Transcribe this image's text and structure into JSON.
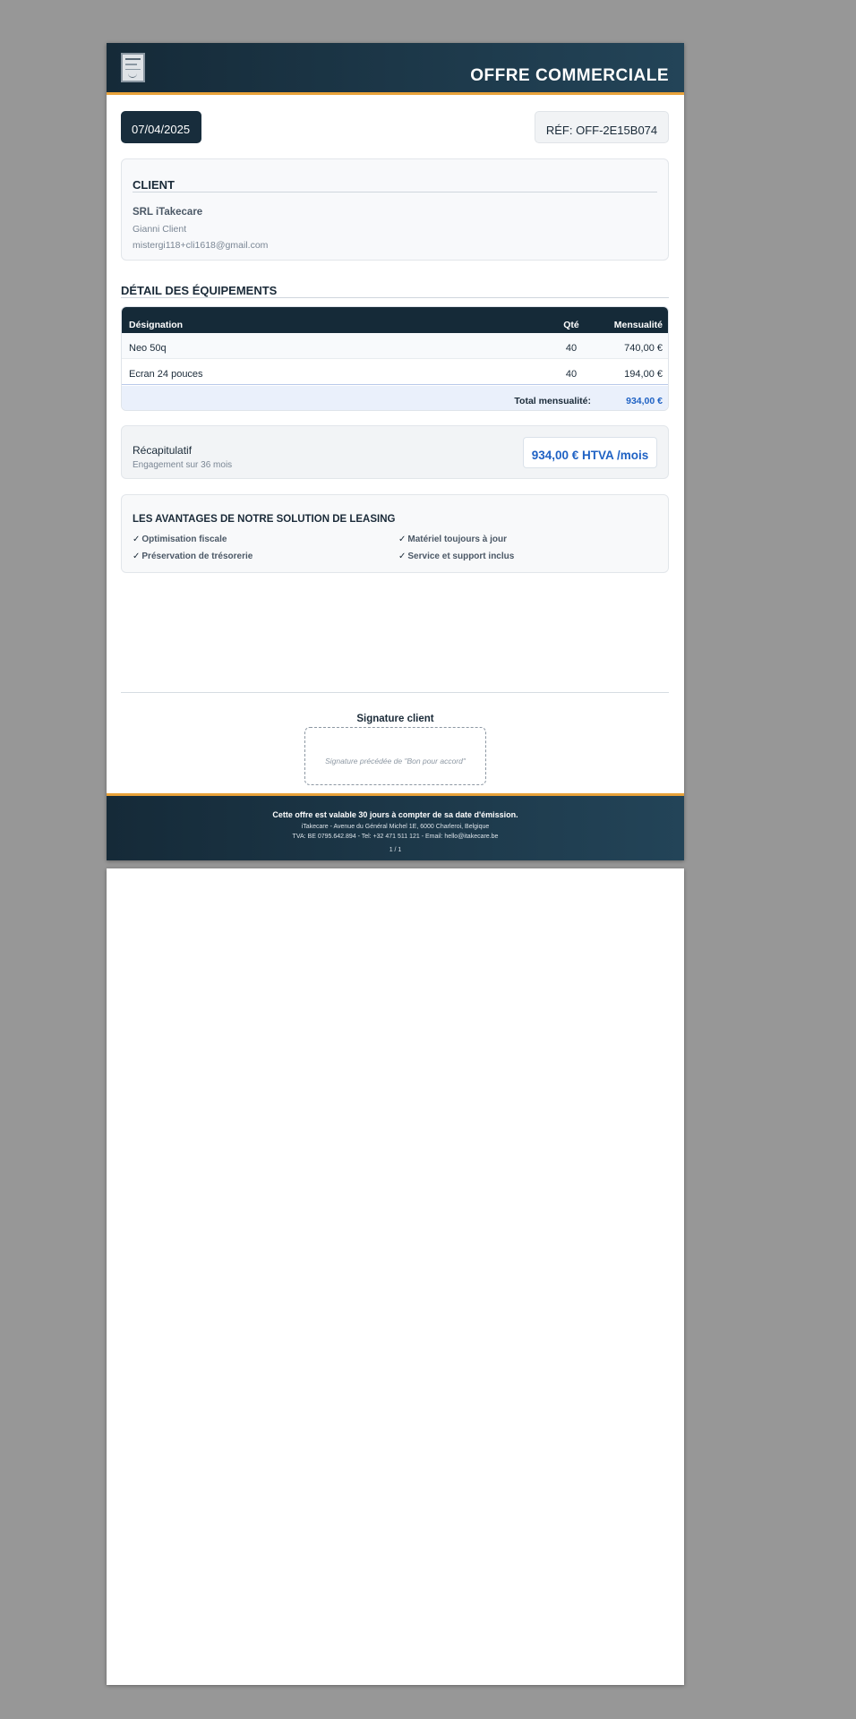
{
  "header": {
    "title": "OFFRE COMMERCIALE",
    "logo_icon": "company-logo"
  },
  "meta": {
    "date": "07/04/2025",
    "reference": "RÉF: OFF-2E15B074"
  },
  "client": {
    "heading": "CLIENT",
    "company": "SRL iTakecare",
    "name": "Gianni Client",
    "email": "mistergi118+cli1618@gmail.com"
  },
  "equipment": {
    "title": "DÉTAIL DES ÉQUIPEMENTS",
    "columns": {
      "designation": "Désignation",
      "quantity": "Qté",
      "monthly": "Mensualité"
    },
    "rows": [
      {
        "designation": "Neo 50q",
        "quantity": "40",
        "monthly": "740,00 €"
      },
      {
        "designation": "Ecran 24 pouces",
        "quantity": "40",
        "monthly": "194,00 €"
      }
    ],
    "total_label": "Total mensualité:",
    "total_value": "934,00 €"
  },
  "recap": {
    "title": "Récapitulatif",
    "subtitle": "Engagement sur 36 mois",
    "price": "934,00 € HTVA /mois"
  },
  "advantages": {
    "title": "LES AVANTAGES DE NOTRE SOLUTION DE LEASING",
    "check_symbol": "✓",
    "items": [
      "Optimisation fiscale",
      "Matériel toujours à jour",
      "Préservation de trésorerie",
      "Service et support inclus"
    ]
  },
  "signature": {
    "label": "Signature client",
    "hint": "Signature précédée de \"Bon pour accord\""
  },
  "footer": {
    "validity": "Cette offre est valable 30 jours à compter de sa date d'émission.",
    "address": "iTakecare - Avenue du Général Michel 1E, 6000 Charleroi, Belgique",
    "contact": "TVA: BE 0795.642.894 - Tel: +32 471 511 121 - Email: hello@itakecare.be",
    "page": "1 / 1"
  },
  "colors": {
    "navy": "#152a38",
    "accent": "#e8a23a",
    "price_blue": "#1f62c4",
    "viewer_bg": "#979797"
  }
}
